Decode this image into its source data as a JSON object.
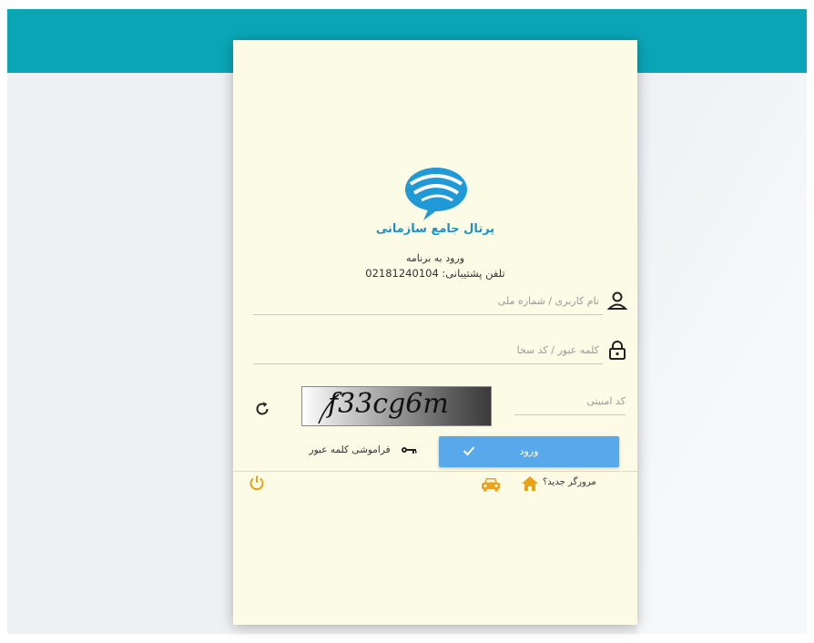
{
  "header": {
    "title": "پرتال جامع سازمانی",
    "subtitle": "ورود به برنامه",
    "phone": "تلفن پشتیبانی: 02181240104"
  },
  "form": {
    "username_placeholder": "نام کاربری / شماره ملی",
    "password_placeholder": "کلمه عبور / کد سخا",
    "captcha_placeholder": "کد امنیتی",
    "captcha_text": "f33cg6m",
    "login_label": "ورود",
    "forgot_label": "فراموشی کلمه عبور"
  },
  "footer": {
    "new_browser_label": "مرورگر جدید؟"
  },
  "colors": {
    "top_bar": "#0aa6b8",
    "card_background": "#fcfbe6",
    "title": "#1c8fc9",
    "login_button": "#58a8ec",
    "footer_icons": "#e8a21b"
  },
  "icons": {
    "logo": "portal-logo",
    "user": "user-icon",
    "lock": "lock-icon",
    "refresh": "refresh-icon",
    "check": "check-icon",
    "key": "key-icon",
    "home": "home-icon",
    "car": "car-icon",
    "power": "power-icon"
  }
}
